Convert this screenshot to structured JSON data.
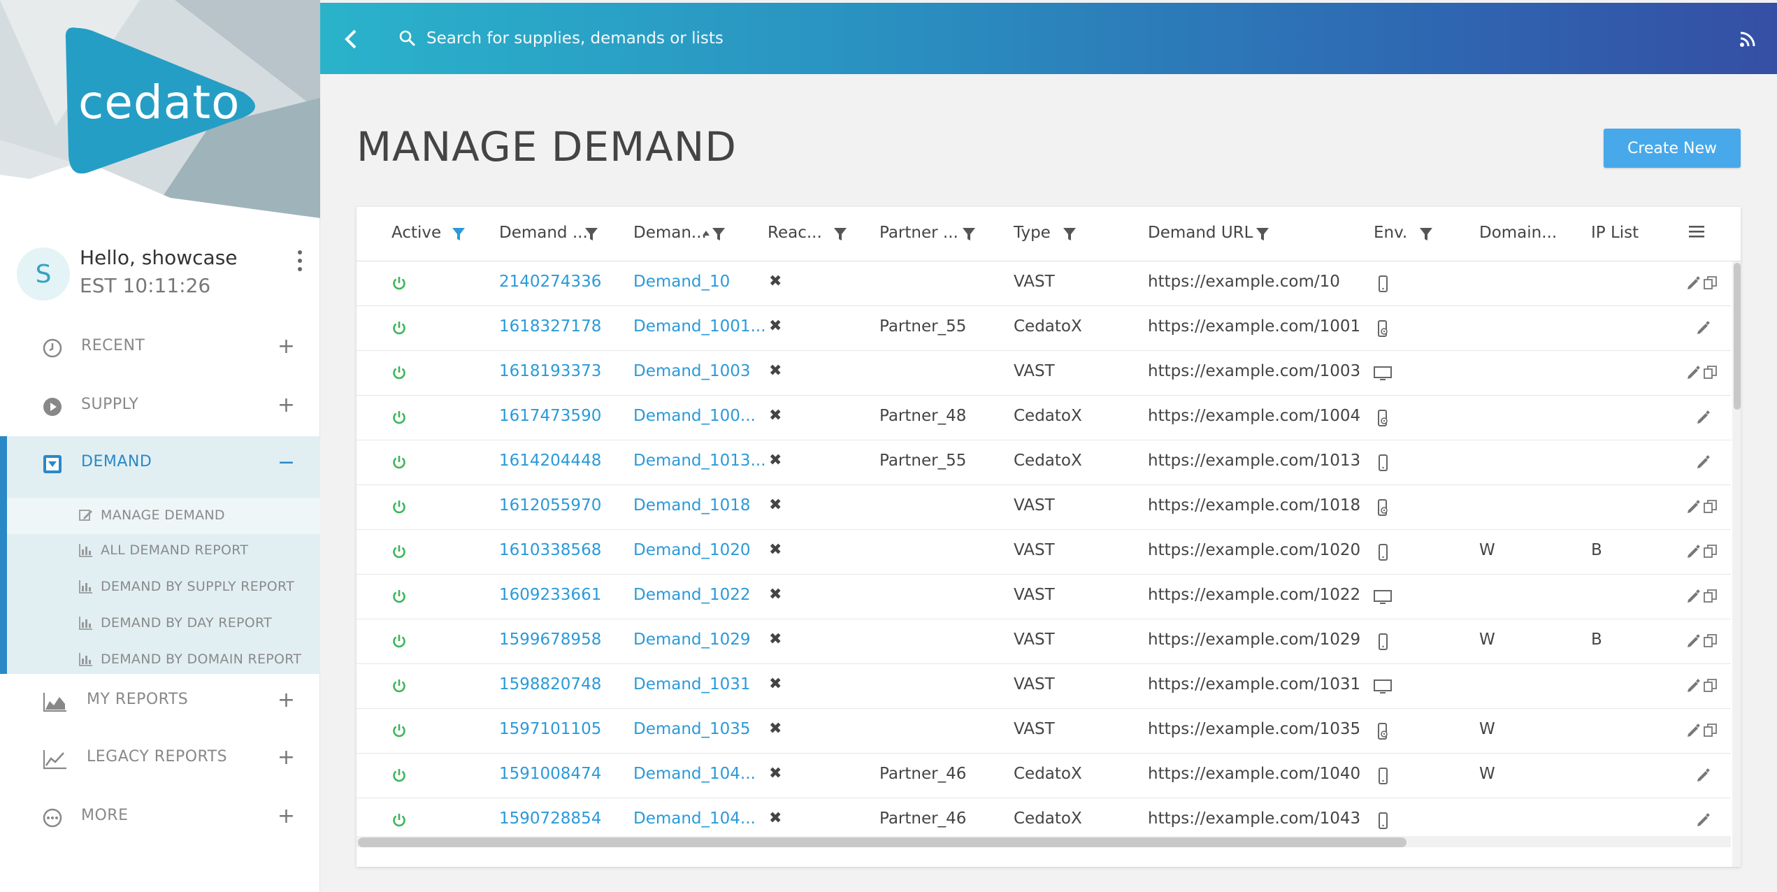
{
  "brand": {
    "logo_text": "cedato"
  },
  "user": {
    "avatar_letter": "S",
    "greeting": "Hello, showcase",
    "clock": "EST 10:11:26"
  },
  "nav": {
    "recent": "RECENT",
    "supply": "SUPPLY",
    "demand": "DEMAND",
    "demand_sub": [
      "MANAGE DEMAND",
      "ALL DEMAND REPORT",
      "DEMAND BY SUPPLY REPORT",
      "DEMAND BY DAY REPORT",
      "DEMAND BY DOMAIN REPORT"
    ],
    "my_reports": "MY REPORTS",
    "legacy_reports": "LEGACY REPORTS",
    "more": "MORE",
    "expand_symbol": "+",
    "collapse_symbol": "−"
  },
  "search": {
    "placeholder": "Search for supplies, demands or lists"
  },
  "page": {
    "title": "MANAGE DEMAND",
    "create_label": "Create New"
  },
  "table": {
    "headers": [
      "Active",
      "Demand ...",
      "Deman...",
      "Reac...",
      "Partner ...",
      "Type",
      "Demand URL",
      "Env.",
      "Domain...",
      "IP List"
    ],
    "rows": [
      {
        "id": "2140274336",
        "name": "Demand_10",
        "reached": "✖",
        "partner": "",
        "type": "VAST",
        "url": "https://example.com/10",
        "env": "mobile",
        "domain": "",
        "ip": "",
        "copy": true
      },
      {
        "id": "1618327178",
        "name": "Demand_1001...",
        "reached": "✖",
        "partner": "Partner_55",
        "type": "CedatoX",
        "url": "https://example.com/1001",
        "env": "app",
        "domain": "",
        "ip": "",
        "copy": false
      },
      {
        "id": "1618193373",
        "name": "Demand_1003",
        "reached": "✖",
        "partner": "",
        "type": "VAST",
        "url": "https://example.com/1003",
        "env": "desktop",
        "domain": "",
        "ip": "",
        "copy": true
      },
      {
        "id": "1617473590",
        "name": "Demand_100...",
        "reached": "✖",
        "partner": "Partner_48",
        "type": "CedatoX",
        "url": "https://example.com/1004",
        "env": "app",
        "domain": "",
        "ip": "",
        "copy": false
      },
      {
        "id": "1614204448",
        "name": "Demand_1013...",
        "reached": "✖",
        "partner": "Partner_55",
        "type": "CedatoX",
        "url": "https://example.com/1013",
        "env": "mobile",
        "domain": "",
        "ip": "",
        "copy": false
      },
      {
        "id": "1612055970",
        "name": "Demand_1018",
        "reached": "✖",
        "partner": "",
        "type": "VAST",
        "url": "https://example.com/1018",
        "env": "app",
        "domain": "",
        "ip": "",
        "copy": true
      },
      {
        "id": "1610338568",
        "name": "Demand_1020",
        "reached": "✖",
        "partner": "",
        "type": "VAST",
        "url": "https://example.com/1020",
        "env": "mobile",
        "domain": "W",
        "ip": "B",
        "copy": true
      },
      {
        "id": "1609233661",
        "name": "Demand_1022",
        "reached": "✖",
        "partner": "",
        "type": "VAST",
        "url": "https://example.com/1022",
        "env": "desktop",
        "domain": "",
        "ip": "",
        "copy": true
      },
      {
        "id": "1599678958",
        "name": "Demand_1029",
        "reached": "✖",
        "partner": "",
        "type": "VAST",
        "url": "https://example.com/1029",
        "env": "mobile",
        "domain": "W",
        "ip": "B",
        "copy": true
      },
      {
        "id": "1598820748",
        "name": "Demand_1031",
        "reached": "✖",
        "partner": "",
        "type": "VAST",
        "url": "https://example.com/1031",
        "env": "desktop",
        "domain": "",
        "ip": "",
        "copy": true
      },
      {
        "id": "1597101105",
        "name": "Demand_1035",
        "reached": "✖",
        "partner": "",
        "type": "VAST",
        "url": "https://example.com/1035",
        "env": "app",
        "domain": "W",
        "ip": "",
        "copy": true
      },
      {
        "id": "1591008474",
        "name": "Demand_104...",
        "reached": "✖",
        "partner": "Partner_46",
        "type": "CedatoX",
        "url": "https://example.com/1040",
        "env": "mobile",
        "domain": "W",
        "ip": "",
        "copy": false
      },
      {
        "id": "1590728854",
        "name": "Demand_104...",
        "reached": "✖",
        "partner": "Partner_46",
        "type": "CedatoX",
        "url": "https://example.com/1043",
        "env": "mobile",
        "domain": "",
        "ip": "",
        "copy": false
      }
    ]
  },
  "colors": {
    "accent": "#2a88c7",
    "link": "#2a9ad9",
    "active_power": "#3cb55a",
    "create_button": "#47a9ea"
  },
  "icons": {
    "back": "chevron-left-icon",
    "search": "search-icon",
    "feed": "rss-icon",
    "active": "power-icon",
    "edit": "pencil-icon",
    "copy": "copy-icon",
    "menu": "hamburger-icon"
  }
}
